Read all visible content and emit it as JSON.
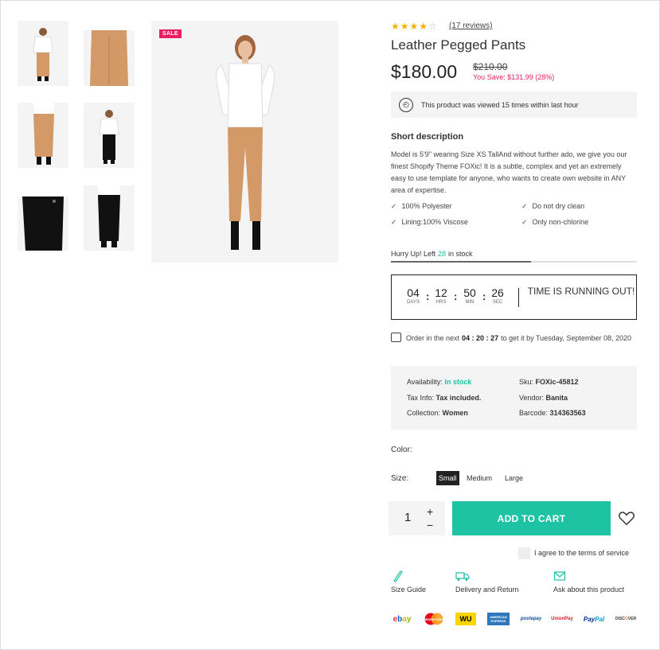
{
  "gallery": {
    "sale_badge": "SALE",
    "thumbnails": [
      "thumb-full-front",
      "thumb-pants-detail",
      "thumb-pants-side",
      "thumb-black-outfit",
      "thumb-black-pants-detail",
      "thumb-black-pants-back"
    ]
  },
  "product": {
    "rating": 4,
    "rating_max": 5,
    "reviews_label": "(17 reviews)",
    "title": "Leather Pegged Pants",
    "price": "$180.00",
    "old_price": "$210.00",
    "you_save": "You Save: $131.99 (28%)",
    "viewed_text": "This product was viewed 15 times within last hour"
  },
  "short_description": {
    "title": "Short description",
    "text": "Model is 5'9\" wearing Size XS TallAnd without further ado, we give you our finest Shopify Theme FOXic! It is a subtle, complex and yet an extremely easy to use template for anyone, who wants to create own website in ANY area of expertise.",
    "features": [
      "100% Polyester",
      "Do not dry clean",
      "Lining:100% Viscose",
      "Only non-chlorine"
    ]
  },
  "stock": {
    "prefix": "Hurry Up! Left",
    "count": "28",
    "suffix": "in stock",
    "level": 0.57
  },
  "countdown": {
    "days": "04",
    "days_label": "DAYS",
    "hours": "12",
    "hours_label": "HRS",
    "minutes": "50",
    "minutes_label": "MIN",
    "seconds": "26",
    "seconds_label": "SEC",
    "message": "TIME IS RUNNING OUT!"
  },
  "delivery": {
    "prefix": "Order in the next",
    "time": "04 : 20 : 27",
    "suffix": "to get it by Tuesday, September 08, 2020"
  },
  "meta": {
    "availability_label": "Availability:",
    "availability_value": "In stock",
    "sku_label": "Sku:",
    "sku_value": "FOXic-45812",
    "tax_label": "Tax Info:",
    "tax_value": "Tax included.",
    "vendor_label": "Vendor:",
    "vendor_value": "Banita",
    "collection_label": "Collection:",
    "collection_value": "Women",
    "barcode_label": "Barcode:",
    "barcode_value": "314363563"
  },
  "options": {
    "color_label": "Color:",
    "size_label": "Size:",
    "sizes": [
      "Small",
      "Medium",
      "Large"
    ],
    "selected_size": "Small"
  },
  "cart": {
    "quantity": "1",
    "plus": "+",
    "minus": "−",
    "add_label": "ADD TO CART",
    "terms_label": "I agree to the terms of service"
  },
  "links": {
    "size_guide": "Size Guide",
    "delivery": "Delivery and Return",
    "ask": "Ask about this product"
  },
  "payments": [
    "ebay",
    "MasterCard",
    "WU",
    "AMERICAN EXPRESS",
    "postepay",
    "UnionPay",
    "PayPal",
    "DISCOVER"
  ],
  "colors": {
    "accent": "#1ec3a4",
    "sale": "#e91e63",
    "save": "#e0245e",
    "star": "#f5b301"
  }
}
